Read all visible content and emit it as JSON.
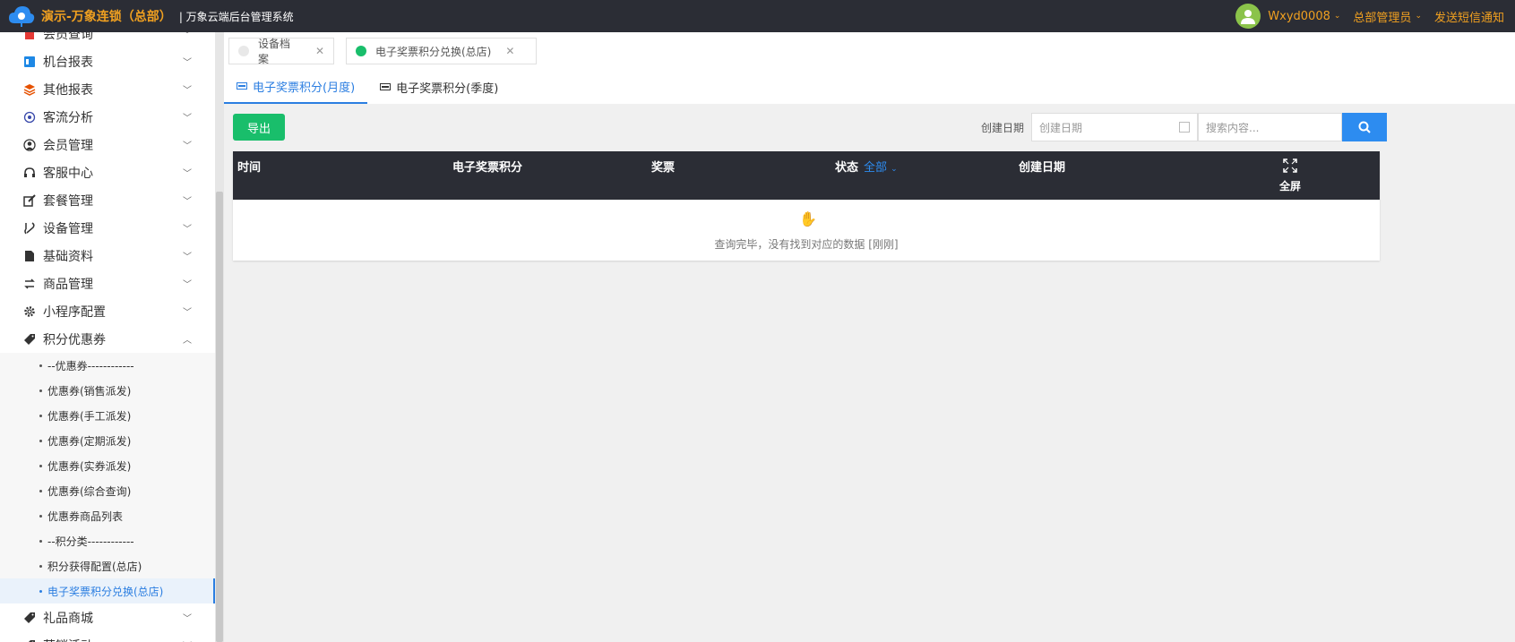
{
  "header": {
    "brand": "演示-万象连锁（总部）",
    "system": "| 万象云端后台管理系统",
    "user": "Wxyd0008",
    "role": "总部管理员",
    "sms": "发送短信通知",
    "colors": {
      "bar": "#2b2d35",
      "accent": "#f0a020"
    }
  },
  "sidebar": {
    "menu": [
      {
        "label": "会员查询",
        "icon": "book-icon",
        "color": "#e53935"
      },
      {
        "label": "机台报表",
        "icon": "report-icon",
        "color": "#1e88e5"
      },
      {
        "label": "其他报表",
        "icon": "layers-icon",
        "color": "#e65100"
      },
      {
        "label": "客流分析",
        "icon": "target-icon",
        "color": "#3949ab"
      },
      {
        "label": "会员管理",
        "icon": "user-icon",
        "color": "#333333"
      },
      {
        "label": "客服中心",
        "icon": "headset-icon",
        "color": "#333333"
      },
      {
        "label": "套餐管理",
        "icon": "edit-icon",
        "color": "#333333"
      },
      {
        "label": "设备管理",
        "icon": "wrench-icon",
        "color": "#333333"
      },
      {
        "label": "基础资料",
        "icon": "file-icon",
        "color": "#333333"
      },
      {
        "label": "商品管理",
        "icon": "swap-icon",
        "color": "#333333"
      },
      {
        "label": "小程序配置",
        "icon": "gear-icon",
        "color": "#333333"
      },
      {
        "label": "积分优惠券",
        "icon": "tag-icon",
        "color": "#333333"
      }
    ],
    "sub_items": [
      {
        "label": "--优惠券------------"
      },
      {
        "label": "优惠券(销售派发)"
      },
      {
        "label": "优惠券(手工派发)"
      },
      {
        "label": "优惠券(定期派发)"
      },
      {
        "label": "优惠券(实券派发)"
      },
      {
        "label": "优惠券(综合查询)"
      },
      {
        "label": "优惠券商品列表"
      },
      {
        "label": "--积分类------------"
      },
      {
        "label": "积分获得配置(总店)"
      },
      {
        "label": "电子奖票积分兑换(总店)"
      }
    ],
    "after": [
      {
        "label": "礼品商城",
        "icon": "gift-tag-icon"
      },
      {
        "label": "营销活动",
        "icon": "gift-tag-icon"
      }
    ]
  },
  "page_tabs": [
    {
      "label": "设备档案",
      "active": false
    },
    {
      "label": "电子奖票积分兑换(总店)",
      "active": true
    }
  ],
  "sub_tabs": [
    {
      "label": "电子奖票积分(月度)",
      "active": true
    },
    {
      "label": "电子奖票积分(季度)",
      "active": false
    }
  ],
  "toolbar": {
    "export": "导出",
    "date_label": "创建日期",
    "date_placeholder": "创建日期",
    "search_placeholder": "搜索内容..."
  },
  "table": {
    "columns": [
      "时间",
      "电子奖票积分",
      "奖票",
      "状态",
      "创建日期"
    ],
    "status_filter": "全部",
    "fullscreen": "全屏",
    "empty_text": "查询完毕，没有找到对应的数据 [刚刚]"
  }
}
